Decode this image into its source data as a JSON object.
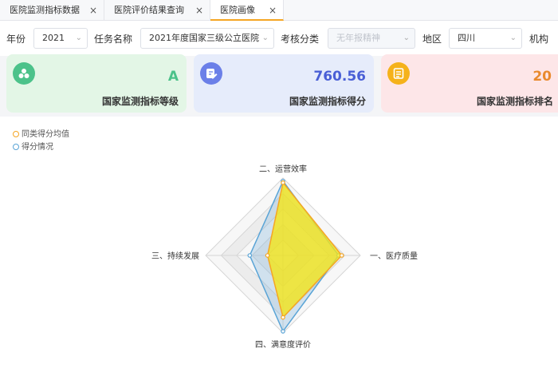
{
  "tabs": [
    {
      "label": "医院监测指标数据",
      "close": "×",
      "active": false
    },
    {
      "label": "医院评价结果查询",
      "close": "×",
      "active": false
    },
    {
      "label": "医院画像",
      "close": "×",
      "active": true
    }
  ],
  "filters": {
    "year_label": "年份",
    "year_value": "2021",
    "task_label": "任务名称",
    "task_value": "2021年度国家三级公立医院",
    "category_label": "考核分类",
    "category_placeholder": "无年报精神",
    "region_label": "地区",
    "region_value": "四川",
    "org_label": "机构"
  },
  "cards": [
    {
      "value": "A",
      "caption": "国家监测指标等级",
      "icon": "cluster-dots-icon",
      "bg": "#e3f6e6",
      "icon_bg": "#4cc28a",
      "value_color": "#4cc28a"
    },
    {
      "value": "760.56",
      "caption": "国家监测指标得分",
      "icon": "edit-note-icon",
      "bg": "#e6ecfb",
      "icon_bg": "#6b7fe8",
      "value_color": "#4a5fd6"
    },
    {
      "value": "20",
      "caption": "国家监测指标排名",
      "icon": "document-list-icon",
      "bg": "#fde6e8",
      "icon_bg": "#f5b21b",
      "value_color": "#e98a2e"
    }
  ],
  "legend": [
    {
      "label": "同类得分均值",
      "color": "#f5a623"
    },
    {
      "label": "得分情况",
      "color": "#5aa4d6"
    }
  ],
  "chart_data": {
    "type": "radar",
    "indicators": [
      "一、医疗质量",
      "二、运营效率",
      "三、持续发展",
      "四、满意度评价"
    ],
    "max": 1,
    "series": [
      {
        "name": "同类得分均值",
        "values": [
          0.76,
          0.94,
          0.2,
          0.8
        ],
        "color": "#f5a623"
      },
      {
        "name": "得分情况",
        "values": [
          0.72,
          0.96,
          0.43,
          0.98
        ],
        "color": "#5aa4d6"
      }
    ]
  }
}
